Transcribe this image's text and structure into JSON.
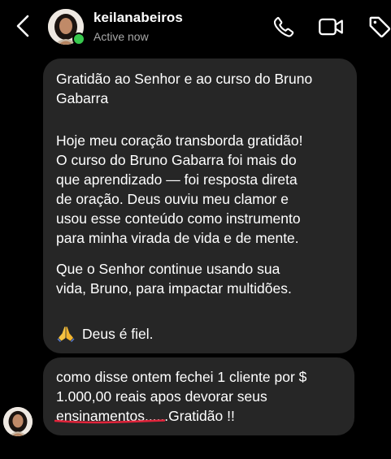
{
  "header": {
    "username": "keilanabeiros",
    "status": "Active now",
    "colors": {
      "background": "#000000",
      "status_text": "#a8a8a8",
      "online_dot": "#38c94e"
    },
    "icons": [
      "chevron-left-icon",
      "phone-icon",
      "video-camera-icon",
      "tag-icon"
    ]
  },
  "messages": {
    "bubble_color": "#262626",
    "first": {
      "title": "Gratidão ao Senhor e ao curso do Bruno\nGabarra",
      "paragraph1": "Hoje meu coração transborda gratidão!\nO curso do Bruno Gabarra foi mais do\nque aprendizado — foi resposta direta\nde oração. Deus ouviu meu clamor e\nusou esse conteúdo como instrumento\npara minha virada de vida e de mente.",
      "paragraph2": "Que o Senhor continue usando sua\nvida, Bruno, para impactar multidões.",
      "sign_off": "Deus é fiel.",
      "sign_off_icon": "praying-hands-icon"
    },
    "second": {
      "line1": "como disse ontem fechei 1 cliente por $",
      "line2": "1.000,00 reais apos devorar seus",
      "line3": "ensinamentos......Gratidão !!",
      "underline_color": "#e0233a"
    }
  }
}
